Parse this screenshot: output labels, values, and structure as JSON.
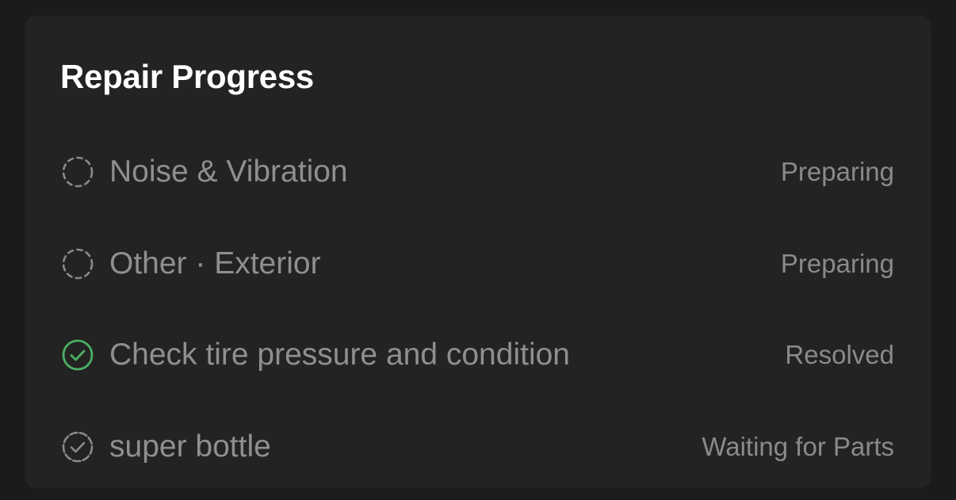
{
  "card": {
    "title": "Repair Progress",
    "items": [
      {
        "label": "Noise & Vibration",
        "status": "Preparing",
        "icon": "dashed-circle-icon"
      },
      {
        "label": "Other · Exterior",
        "status": "Preparing",
        "icon": "dashed-circle-icon"
      },
      {
        "label": "Check tire pressure and condition",
        "status": "Resolved",
        "icon": "check-circle-icon"
      },
      {
        "label": "super bottle",
        "status": "Waiting for Parts",
        "icon": "dashed-check-circle-icon"
      }
    ]
  },
  "colors": {
    "background": "#1a1b1c",
    "card": "#232323",
    "title": "#ffffff",
    "muted_text": "#8f8f8f",
    "resolved_green": "#4caf63",
    "pending_icon": "#8a8a8a"
  }
}
